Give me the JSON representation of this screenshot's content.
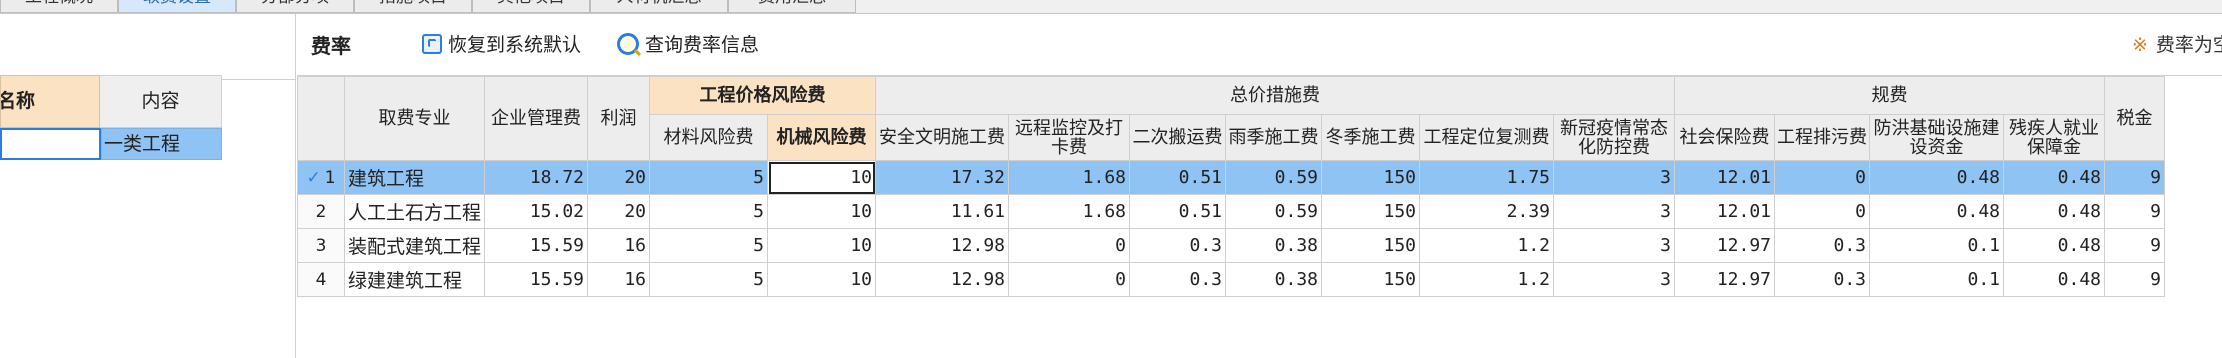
{
  "tabs": [
    {
      "label": "工程概况",
      "active": false
    },
    {
      "label": "取费设置",
      "active": true
    },
    {
      "label": "分部分项",
      "active": false
    },
    {
      "label": "措施项目",
      "active": false
    },
    {
      "label": "其他项目",
      "active": false
    },
    {
      "label": "人材机汇总",
      "active": false
    },
    {
      "label": "费用汇总",
      "active": false
    }
  ],
  "left_panel": {
    "header_name": "名称",
    "header_content": "内容",
    "input_value": "",
    "row_value": "一类工程"
  },
  "toolbar": {
    "title": "费率",
    "restore_label": "恢复到系统默认",
    "query_label": "查询费率信息",
    "note_star": "※",
    "note_text": "费率为空"
  },
  "table": {
    "group_headers": {
      "risk": "工程价格风险费",
      "measures": "总价措施费",
      "regulatory": "规费"
    },
    "headers": {
      "specialty": "取费专业",
      "management": "企业管理费",
      "profit": "利润",
      "material_risk": "材料风险费",
      "machine_risk": "机械风险费",
      "safety": "安全文明施工费",
      "monitoring": "远程监控及打卡费",
      "secondary_transport": "二次搬运费",
      "rainy": "雨季施工费",
      "winter": "冬季施工费",
      "positioning": "工程定位复测费",
      "covid": "新冠疫情常态化防控费",
      "social_insurance": "社会保险费",
      "pollution": "工程排污费",
      "flood": "防洪基础设施建设资金",
      "disability": "残疾人就业保障金",
      "tax": "税金"
    },
    "selected_check": "✓",
    "rows": [
      {
        "no": "1",
        "specialty": "建筑工程",
        "management": "18.72",
        "profit": "20",
        "material_risk": "5",
        "machine_risk": "10",
        "safety": "17.32",
        "monitoring": "1.68",
        "secondary_transport": "0.51",
        "rainy": "0.59",
        "winter": "150",
        "positioning": "1.75",
        "covid": "3",
        "social_insurance": "12.01",
        "pollution": "0",
        "flood": "0.48",
        "disability": "0.48",
        "tax": "9"
      },
      {
        "no": "2",
        "specialty": "人工土石方工程",
        "management": "15.02",
        "profit": "20",
        "material_risk": "5",
        "machine_risk": "10",
        "safety": "11.61",
        "monitoring": "1.68",
        "secondary_transport": "0.51",
        "rainy": "0.59",
        "winter": "150",
        "positioning": "2.39",
        "covid": "3",
        "social_insurance": "12.01",
        "pollution": "0",
        "flood": "0.48",
        "disability": "0.48",
        "tax": "9"
      },
      {
        "no": "3",
        "specialty": "装配式建筑工程",
        "management": "15.59",
        "profit": "16",
        "material_risk": "5",
        "machine_risk": "10",
        "safety": "12.98",
        "monitoring": "0",
        "secondary_transport": "0.3",
        "rainy": "0.38",
        "winter": "150",
        "positioning": "1.2",
        "covid": "3",
        "social_insurance": "12.97",
        "pollution": "0.3",
        "flood": "0.1",
        "disability": "0.48",
        "tax": "9"
      },
      {
        "no": "4",
        "specialty": "绿建建筑工程",
        "management": "15.59",
        "profit": "16",
        "material_risk": "5",
        "machine_risk": "10",
        "safety": "12.98",
        "monitoring": "0",
        "secondary_transport": "0.3",
        "rainy": "0.38",
        "winter": "150",
        "positioning": "1.2",
        "covid": "3",
        "social_insurance": "12.97",
        "pollution": "0.3",
        "flood": "0.1",
        "disability": "0.48",
        "tax": "9"
      }
    ]
  }
}
